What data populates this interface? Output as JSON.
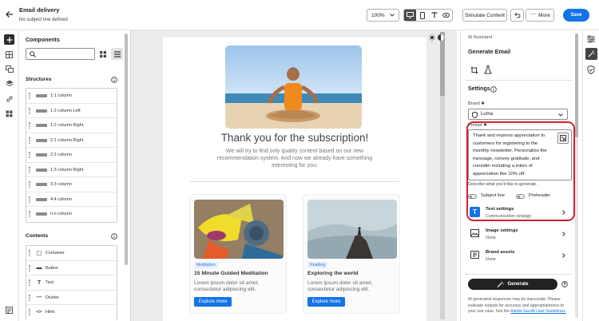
{
  "header": {
    "title": "Email delivery",
    "subtitle": "No subject line defined"
  },
  "toolbar": {
    "zoom": "100%",
    "simulate": "Simulate Content",
    "more": "More",
    "save": "Save"
  },
  "components": {
    "title": "Components",
    "structures_title": "Structures",
    "structures": [
      "1:1 column",
      "1:2 column Left",
      "1:2 column Right",
      "2:1 column Right",
      "2:2 column",
      "1:3 column Right",
      "3:3 column",
      "4:4 column",
      "n:n column"
    ],
    "contents_title": "Contents",
    "contents": [
      {
        "label": "Container",
        "icon": "container-icon"
      },
      {
        "label": "Button",
        "icon": "button-icon"
      },
      {
        "label": "Text",
        "icon": "text-icon"
      },
      {
        "label": "Divider",
        "icon": "divider-icon"
      },
      {
        "label": "Html",
        "icon": "html-icon"
      }
    ]
  },
  "email": {
    "headline": "Thank you for the subscription!",
    "intro": "We will try to find only quality content based on our new recommendation system. And now we already have something interesting for you:",
    "cards": [
      {
        "tag": "Meditation",
        "title": "15 Minute Guided Meditation",
        "body": "Lorem ipsum dolor sit amet, consectetur adipiscing elit.",
        "button": "Explore more"
      },
      {
        "tag": "Reading",
        "title": "Exploring the world",
        "body": "Lorem ipsum dolor sit amet, consectetur adipiscing elit.",
        "button": "Explore more"
      }
    ]
  },
  "ai": {
    "section": "AI Assistant",
    "title": "Generate Email",
    "settings": "Settings",
    "brand_label": "Brand",
    "brand_value": "Luma",
    "prompt_label": "Prompt",
    "prompt_text": "Thank and express appreciation to customers for registering to the monthly newsletter. Personalize the message, convey gratitude, and consider including a token of appreciation like 10% off.",
    "prompt_help": "Describe what you'd like to generate.",
    "subject_line": "Subject line",
    "preheader": "Preheader",
    "text_settings": "Text settings",
    "text_settings_sub": "Communication strategy",
    "image_settings": "Image settings",
    "image_settings_sub": "None",
    "brand_assets": "Brand assets",
    "brand_assets_sub": "None",
    "generate": "Generate",
    "disclaimer_1": "AI generated responses may be inaccurate. Please evaluate outputs for accuracy and appropriateness to your use case. See the",
    "disclaimer_link": "Adobe GenAI User Guidelines.",
    "highlight_color": "#d7202a",
    "accent_color": "#1473e6"
  }
}
